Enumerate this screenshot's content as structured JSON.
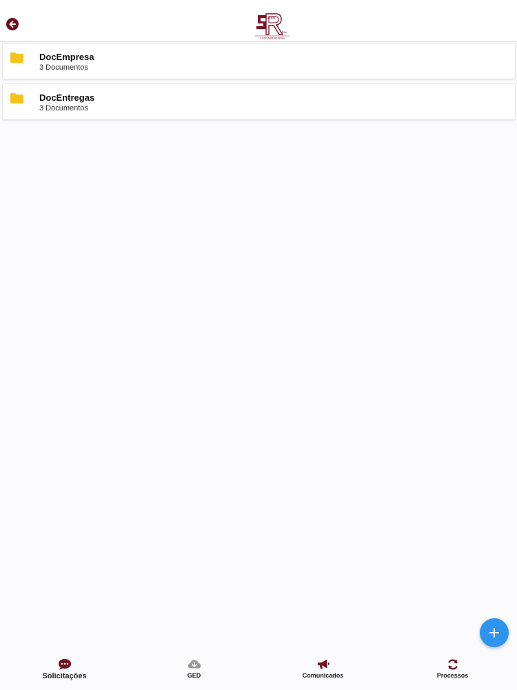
{
  "header": {
    "logo_text_top": "anta",
    "logo_text_bottom": "CONTABILIDADES",
    "logo_text_small": "Rita"
  },
  "folders": [
    {
      "name": "DocEmpresa",
      "count": "3 Documentos"
    },
    {
      "name": "DocEntregas",
      "count": "3 Documentos"
    }
  ],
  "fab": {
    "label": "+"
  },
  "nav": {
    "items": [
      {
        "label": "Solicitações",
        "icon": "chat-icon"
      },
      {
        "label": "GED",
        "icon": "cloud-download-icon"
      },
      {
        "label": "Comunicados",
        "icon": "megaphone-icon"
      },
      {
        "label": "Processos",
        "icon": "refresh-icon"
      }
    ]
  },
  "colors": {
    "brand": "#6d1020",
    "folder": "#f6c31c",
    "fab": "#2d95ef",
    "inactive_icon": "#9a9a9a"
  }
}
